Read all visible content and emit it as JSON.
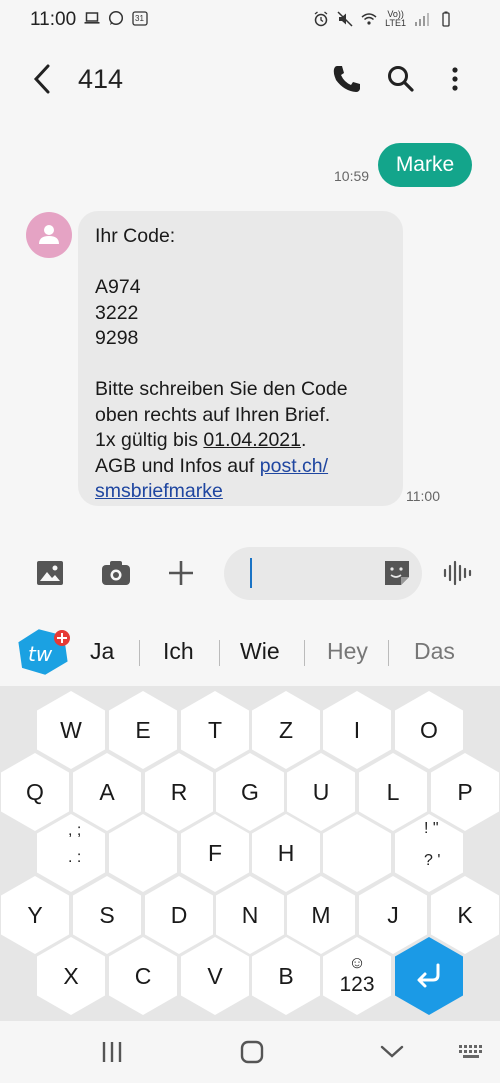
{
  "status_bar": {
    "time": "11:00",
    "left_icons": [
      "laptop-icon",
      "whatsapp-icon",
      "calendar-icon"
    ],
    "calendar_day": "31",
    "right_icons": [
      "alarm-icon",
      "mute-icon",
      "wifi-icon",
      "volte-icon",
      "signal-icon",
      "battery-icon"
    ],
    "volte_label": "Vo))",
    "lte_label": "LTE1"
  },
  "header": {
    "title": "414",
    "back_icon": "back-arrow-icon",
    "call_icon": "phone-icon",
    "search_icon": "search-icon",
    "menu_icon": "more-vert-icon"
  },
  "messages": {
    "sent": {
      "text": "Marke",
      "time": "10:59"
    },
    "received": {
      "lines": [
        "Ihr Code:",
        "",
        "A974",
        "3222",
        "9298",
        "",
        "Bitte schreiben Sie den Code",
        "oben rechts auf Ihren Brief."
      ],
      "line9_prefix": "1x gültig bis ",
      "line9_date": "01.04.2021",
      "line9_suffix": ".",
      "line10_prefix": "AGB und Infos auf ",
      "link_part1": "post.ch/",
      "link_part2": "smsbriefmarke",
      "time": "11:00"
    }
  },
  "compose": {
    "icons": [
      "image-icon",
      "camera-icon",
      "plus-icon",
      "sticker-icon",
      "voice-icon"
    ],
    "input_value": "",
    "input_placeholder": ""
  },
  "suggestions": {
    "items": [
      "Ja",
      "Ich",
      "Wie",
      "Hey",
      "Das"
    ],
    "logo_text": "tw"
  },
  "keyboard": {
    "row1": [
      "W",
      "E",
      "T",
      "Z",
      "I",
      "O"
    ],
    "row2": [
      "Q",
      "A",
      "R",
      "G",
      "U",
      "L",
      "P"
    ],
    "row3_punct_left_top": ", ;",
    "row3_punct_left_bottom": ". :",
    "row3_letters": [
      "F",
      "H"
    ],
    "row3_punct_right_top": "! \"",
    "row3_punct_right_bottom": "? '",
    "row4": [
      "Y",
      "S",
      "D",
      "N",
      "M",
      "J",
      "K"
    ],
    "row5": [
      "X",
      "C",
      "V",
      "B"
    ],
    "numbers_key": "123",
    "emoji_key": "☺",
    "enter_color": "#1b9ae6"
  },
  "nav_bar": {
    "icons": [
      "recent-apps-icon",
      "home-icon",
      "back-down-icon",
      "keyboard-icon"
    ]
  },
  "colors": {
    "sent_bubble": "#13a58b",
    "link": "#1f46a0",
    "avatar": "#e5a3c4",
    "cursor": "#1a73c5"
  }
}
